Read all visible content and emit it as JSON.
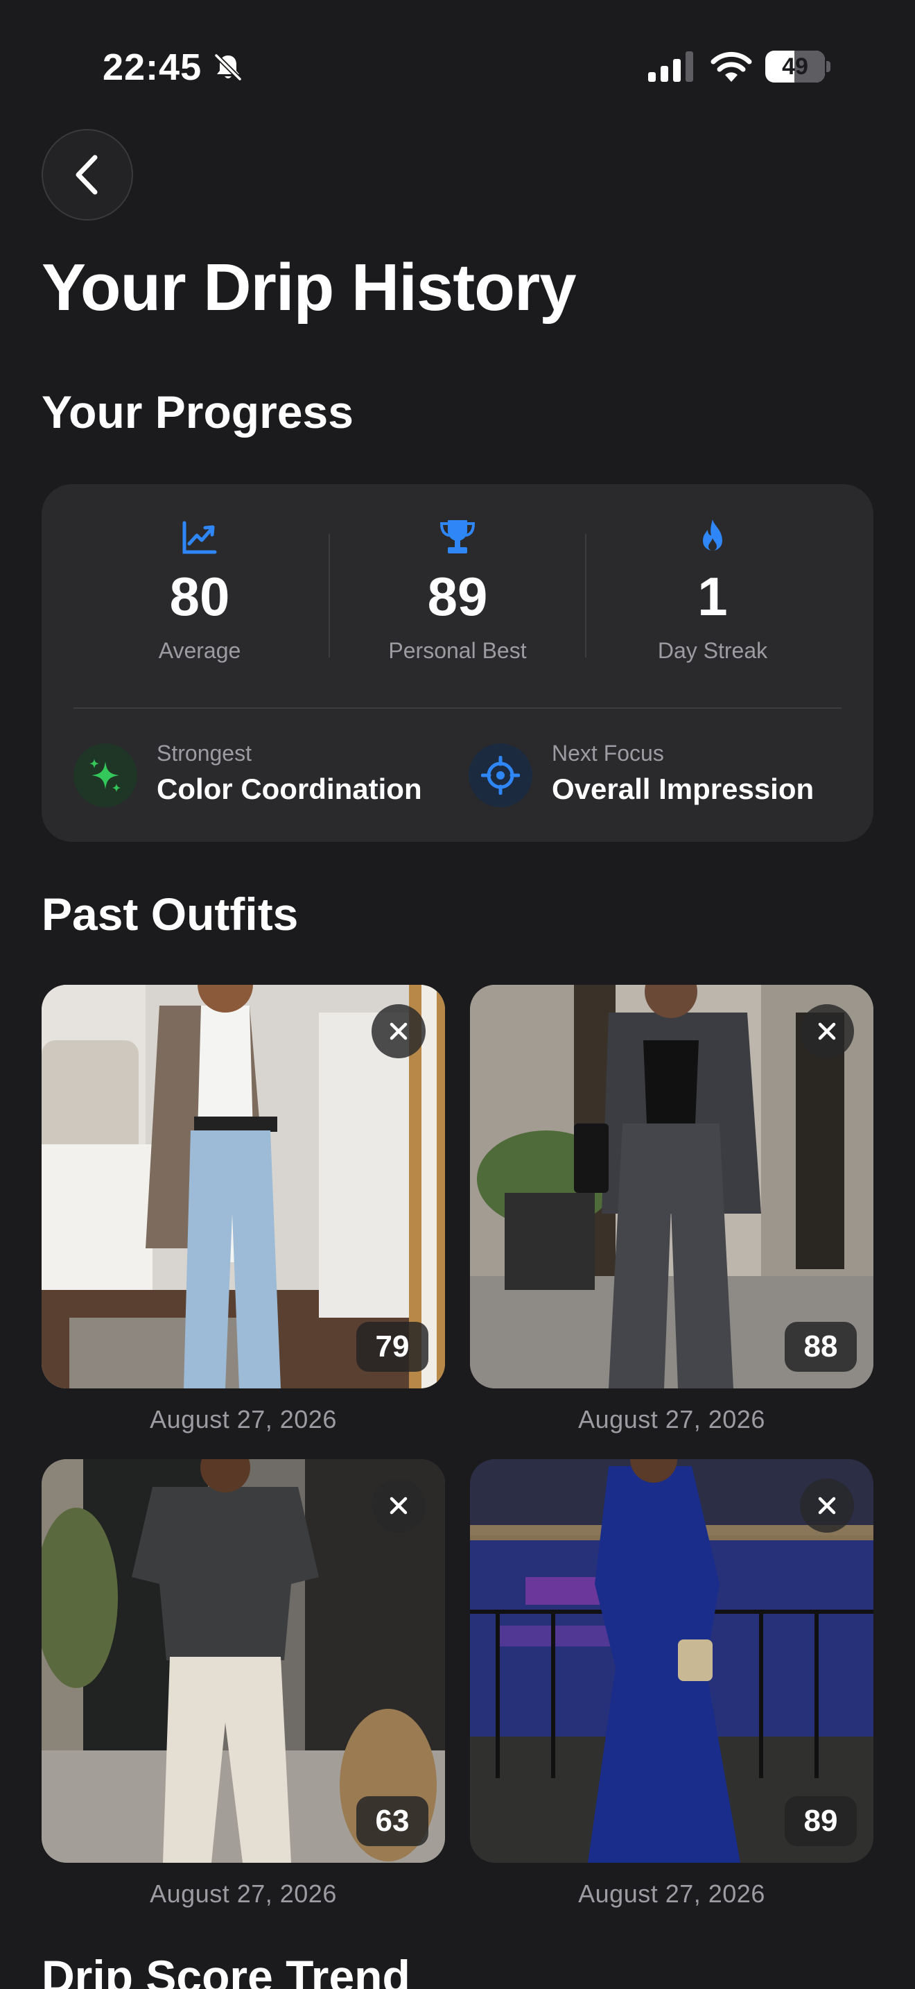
{
  "status_bar": {
    "time": "22:45",
    "battery": "49",
    "battery_level": 0.49
  },
  "header": {
    "title": "Your Drip History"
  },
  "progress": {
    "section_title": "Your Progress",
    "stats": [
      {
        "value": "80",
        "label": "Average",
        "icon": "chart-line-icon",
        "color": "#2f86f6"
      },
      {
        "value": "89",
        "label": "Personal Best",
        "icon": "trophy-icon",
        "color": "#2f86f6"
      },
      {
        "value": "1",
        "label": "Day Streak",
        "icon": "flame-icon",
        "color": "#2f86f6"
      }
    ],
    "strongest": {
      "label": "Strongest",
      "value": "Color Coordination",
      "icon": "sparkles-icon",
      "color": "#34c759"
    },
    "next_focus": {
      "label": "Next Focus",
      "value": "Overall Impression",
      "icon": "target-icon",
      "color": "#2f86f6"
    }
  },
  "past_outfits": {
    "section_title": "Past Outfits",
    "items": [
      {
        "score": "79",
        "date": "August 27, 2026"
      },
      {
        "score": "88",
        "date": "August 27, 2026"
      },
      {
        "score": "63",
        "date": "August 27, 2026"
      },
      {
        "score": "89",
        "date": "August 27, 2026"
      }
    ]
  },
  "trend": {
    "section_title": "Drip Score Trend"
  }
}
